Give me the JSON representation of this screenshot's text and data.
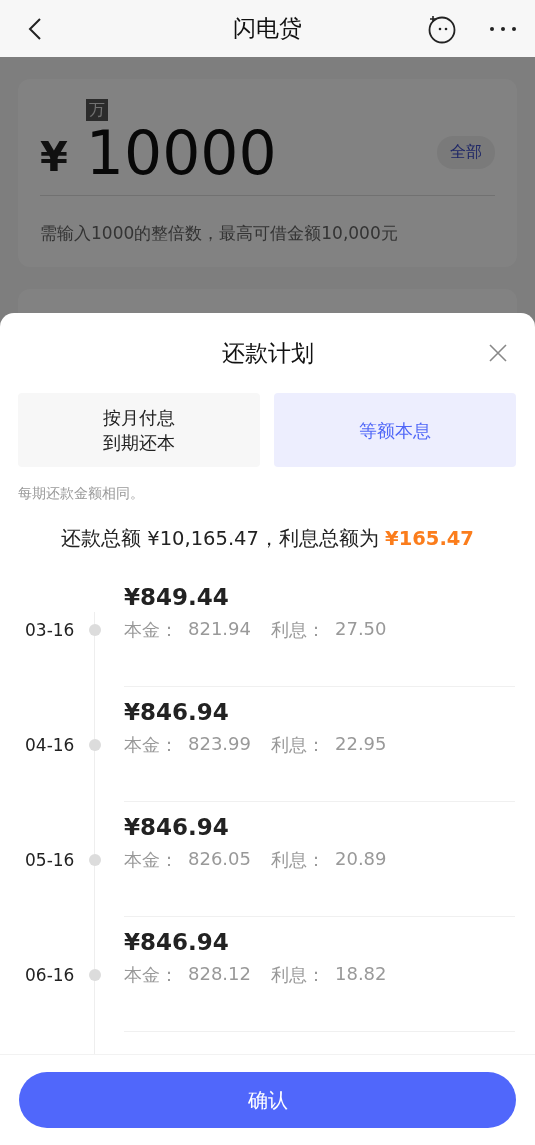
{
  "nav_bar": {
    "title": "闪电贷"
  },
  "loan_form": {
    "currency": "¥",
    "amount": "10000",
    "unit_hint": "万",
    "all_button": "全部",
    "hint": "需输入1000的整倍数，最高可借金额10,000元"
  },
  "overlay": {
    "dimmed": true
  },
  "repayment_sheet": {
    "title": "还款计划",
    "options": [
      {
        "lines": [
          "按月付息",
          "到期还本"
        ],
        "selected": false
      },
      {
        "lines": [
          "等额本息"
        ],
        "selected": true
      }
    ],
    "note": "每期还款金额相同。",
    "summary": {
      "text": "还款总额 ¥10,165.47，利息总额为",
      "highlight": "¥165.47"
    },
    "schedule": [
      {
        "date": "03-16",
        "amount": "¥849.44",
        "principal_label": "本金：",
        "principal": "821.94",
        "interest_label": "利息：",
        "interest": "27.50"
      },
      {
        "date": "04-16",
        "amount": "¥846.94",
        "principal_label": "本金：",
        "principal": "823.99",
        "interest_label": "利息：",
        "interest": "22.95"
      },
      {
        "date": "05-16",
        "amount": "¥846.94",
        "principal_label": "本金：",
        "principal": "826.05",
        "interest_label": "利息：",
        "interest": "20.89"
      },
      {
        "date": "06-16",
        "amount": "¥846.94",
        "principal_label": "本金：",
        "principal": "828.12",
        "interest_label": "利息：",
        "interest": "18.82"
      }
    ],
    "confirm_button": "确认"
  }
}
